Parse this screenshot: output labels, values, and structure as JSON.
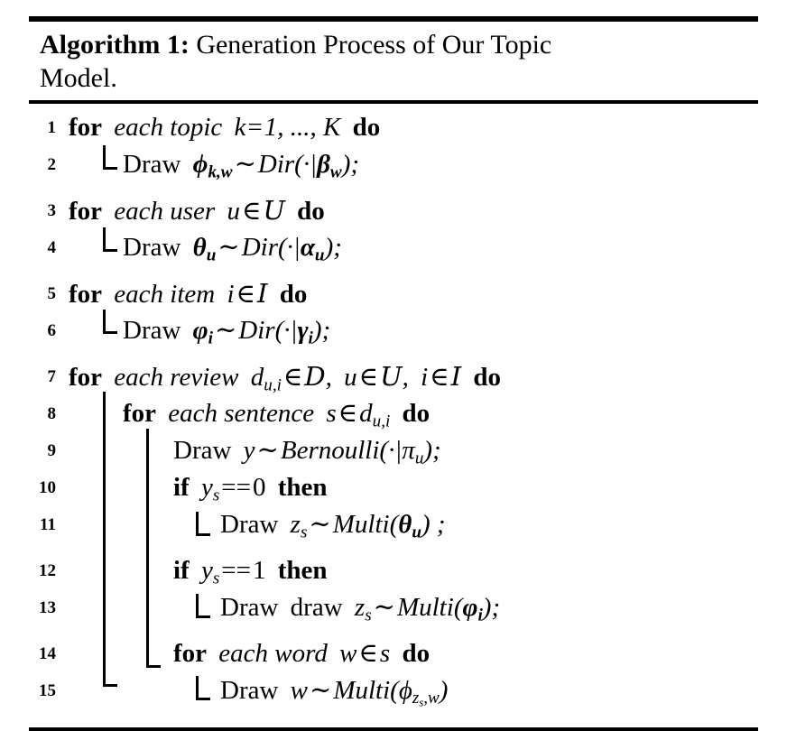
{
  "caption": {
    "label": "Algorithm 1:",
    "text": "Generation Process of Our Topic",
    "text_line2": "Model."
  },
  "algorithm": {
    "lines": [
      {
        "n": "1",
        "indent": 0,
        "kind": "for"
      },
      {
        "n": "2",
        "indent": 1,
        "kind": "draw"
      },
      {
        "n": "3",
        "indent": 0,
        "kind": "for"
      },
      {
        "n": "4",
        "indent": 1,
        "kind": "draw"
      },
      {
        "n": "5",
        "indent": 0,
        "kind": "for"
      },
      {
        "n": "6",
        "indent": 1,
        "kind": "draw"
      },
      {
        "n": "7",
        "indent": 0,
        "kind": "for"
      },
      {
        "n": "8",
        "indent": 1,
        "kind": "for"
      },
      {
        "n": "9",
        "indent": 2,
        "kind": "draw"
      },
      {
        "n": "10",
        "indent": 2,
        "kind": "if"
      },
      {
        "n": "11",
        "indent": 3,
        "kind": "draw"
      },
      {
        "n": "12",
        "indent": 2,
        "kind": "if"
      },
      {
        "n": "13",
        "indent": 3,
        "kind": "draw"
      },
      {
        "n": "14",
        "indent": 2,
        "kind": "for"
      },
      {
        "n": "15",
        "indent": 3,
        "kind": "draw"
      }
    ],
    "numbers": {
      "l1": "1",
      "l2": "2",
      "l3": "3",
      "l4": "4",
      "l5": "5",
      "l6": "6",
      "l7": "7",
      "l8": "8",
      "l9": "9",
      "l10": "10",
      "l11": "11",
      "l12": "12",
      "l13": "13",
      "l14": "14",
      "l15": "15"
    },
    "keywords": {
      "for": "for",
      "do": "do",
      "if": "if",
      "then": "then",
      "draw": "Draw"
    },
    "statements": {
      "l1": {
        "head": "for",
        "body": "each topic",
        "var": "k",
        "eq": "=",
        "range": "1, ..., K",
        "tail": "do"
      },
      "l2": {
        "verb": "Draw",
        "lhs": "ϕ",
        "lhs_sub": "k,w",
        "op": "∼",
        "dist": "Dir",
        "args": "(·|",
        "param": "β",
        "param_sub": "w",
        "close": ");"
      },
      "l3": {
        "head": "for",
        "body": "each user",
        "var": "u",
        "in": "∈",
        "set": "U",
        "tail": "do"
      },
      "l4": {
        "verb": "Draw",
        "lhs": "θ",
        "lhs_sub": "u",
        "op": "∼",
        "dist": "Dir",
        "args": "(·|",
        "param": "α",
        "param_sub": "u",
        "close": ");"
      },
      "l5": {
        "head": "for",
        "body": "each item",
        "var": "i",
        "in": "∈",
        "set": "I",
        "tail": "do"
      },
      "l6": {
        "verb": "Draw",
        "lhs": "φ",
        "lhs_sub": "i",
        "op": "∼",
        "dist": "Dir",
        "args": "(·|",
        "param": "γ",
        "param_sub": "i",
        "close": ");"
      },
      "l7": {
        "head": "for",
        "body": "each review",
        "var": "d",
        "var_sub": "u,i",
        "in": "∈",
        "set": "D",
        "sep1": ",",
        "var2": "u",
        "in2": "∈",
        "set2": "U",
        "sep2": ",",
        "var3": "i",
        "in3": "∈",
        "set3": "I",
        "tail": "do"
      },
      "l8": {
        "head": "for",
        "body": "each sentence",
        "var": "s",
        "in": "∈",
        "set": "d",
        "set_sub": "u,i",
        "tail": "do"
      },
      "l9": {
        "verb": "Draw",
        "lhs": "y",
        "op": "∼",
        "dist": "Bernoulli",
        "args": "(·|",
        "param": "π",
        "param_sub": "u",
        "close": ");"
      },
      "l10": {
        "head": "if",
        "var": "y",
        "var_sub": "s",
        "cmp": "==",
        "value": "0",
        "tail": "then"
      },
      "l11": {
        "verb": "Draw",
        "lhs": "z",
        "lhs_sub": "s",
        "op": "∼",
        "dist": "Multi",
        "args": "(",
        "param": "θ",
        "param_sub": "u",
        "close": ") ;"
      },
      "l12": {
        "head": "if",
        "var": "y",
        "var_sub": "s",
        "cmp": "==",
        "value": "1",
        "tail": "then"
      },
      "l13": {
        "verb": "Draw",
        "verb2": "draw",
        "lhs": "z",
        "lhs_sub": "s",
        "op": "∼",
        "dist": "Multi",
        "args": "(",
        "param": "φ",
        "param_sub": "i",
        "close": ");"
      },
      "l14": {
        "head": "for",
        "body": "each word",
        "var": "w",
        "in": "∈",
        "set": "s",
        "tail": "do"
      },
      "l15": {
        "verb": "Draw",
        "lhs": "w",
        "op": "∼",
        "dist": "Multi",
        "args": "(",
        "param": "ϕ",
        "param_sub": "z",
        "param_sub2": "s",
        "param_sub3": ",w",
        "close": ")"
      }
    }
  },
  "colors": {
    "ink": "#000000",
    "background": "#ffffff"
  }
}
